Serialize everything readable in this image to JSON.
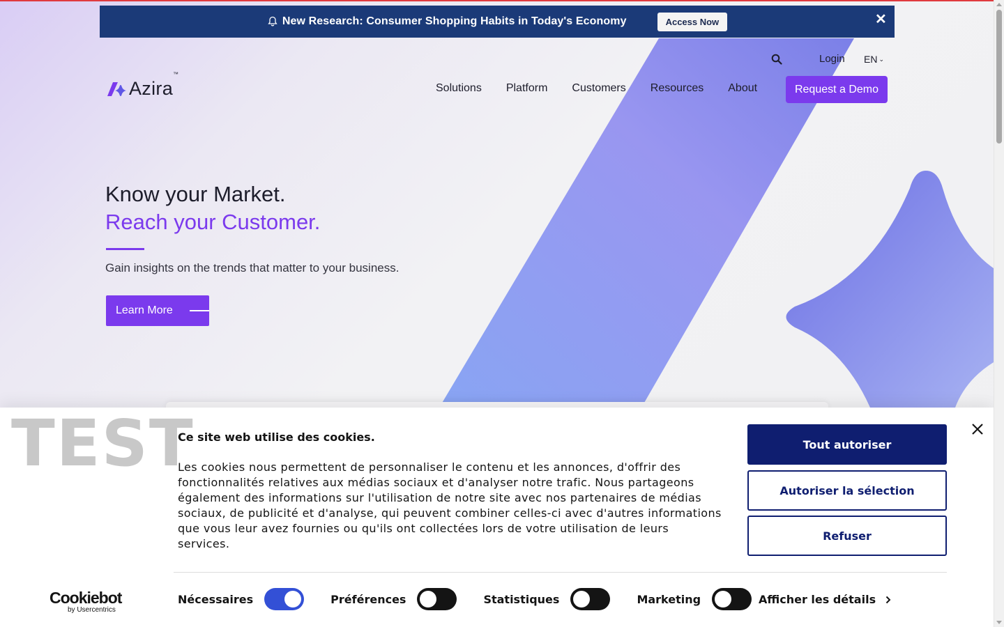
{
  "announcement": {
    "text": "New Research: Consumer Shopping Habits in Today's Economy",
    "cta": "Access Now"
  },
  "utility": {
    "login": "Login",
    "language": "EN"
  },
  "brand": {
    "name": "Azira",
    "tm": "™"
  },
  "nav": {
    "items": [
      "Solutions",
      "Platform",
      "Customers",
      "Resources",
      "About"
    ],
    "cta": "Request a Demo"
  },
  "hero": {
    "headline": "Know your Market.",
    "headline_accent": "Reach your Customer.",
    "subtitle": "Gain insights on the trends that matter to your business.",
    "cta": "Learn More"
  },
  "watermark": "TEST",
  "cookie": {
    "title": "Ce site web utilise des cookies.",
    "body": "Les cookies nous permettent de personnaliser le contenu et les annonces, d'offrir des fonctionnalités relatives aux médias sociaux et d'analyser notre trafic. Nous partageons également des informations sur l'utilisation de notre site avec nos partenaires de médias sociaux, de publicité et d'analyse, qui peuvent combiner celles-ci avec d'autres informations que vous leur avez fournies ou qu'ils ont collectées lors de votre utilisation de leurs services.",
    "allow_all": "Tout autoriser",
    "allow_selection": "Autoriser la sélection",
    "refuse": "Refuser",
    "provider": "Cookiebot",
    "provider_sub": "by Usercentrics",
    "toggles": [
      {
        "label": "Nécessaires",
        "on": true
      },
      {
        "label": "Préférences",
        "on": false
      },
      {
        "label": "Statistiques",
        "on": false
      },
      {
        "label": "Marketing",
        "on": false
      }
    ],
    "details": "Afficher les détails"
  },
  "colors": {
    "accent": "#7b3aed",
    "announce_bg": "#1b3a78",
    "cookie_primary": "#0f1e70"
  }
}
